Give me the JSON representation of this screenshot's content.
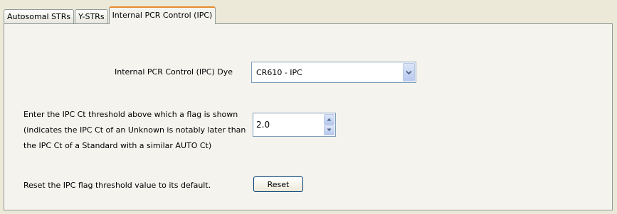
{
  "tabs": [
    {
      "label": "Autosomal STRs"
    },
    {
      "label": "Y-STRs"
    },
    {
      "label": "Internal PCR Control (IPC)"
    }
  ],
  "active_tab": 2,
  "dye": {
    "label": "Internal PCR Control (IPC) Dye",
    "selected": "CR610 - IPC",
    "button_icon": "chevron-down-icon"
  },
  "threshold": {
    "lines": [
      "Enter the IPC Ct threshold above which a flag is shown",
      "(indicates the IPC Ct of an Unknown is notably later than",
      "the IPC Ct of a Standard with a similar AUTO Ct)"
    ],
    "value": "2.0",
    "up_icon": "spin-up-icon",
    "down_icon": "spin-down-icon"
  },
  "reset": {
    "label": "Reset the IPC flag threshold value to its default.",
    "button": "Reset"
  },
  "colors": {
    "background": "#ece9d8",
    "panel": "#f4f3ee",
    "active_tab_accent": "#e68b2c",
    "field_border": "#7f9db9"
  }
}
